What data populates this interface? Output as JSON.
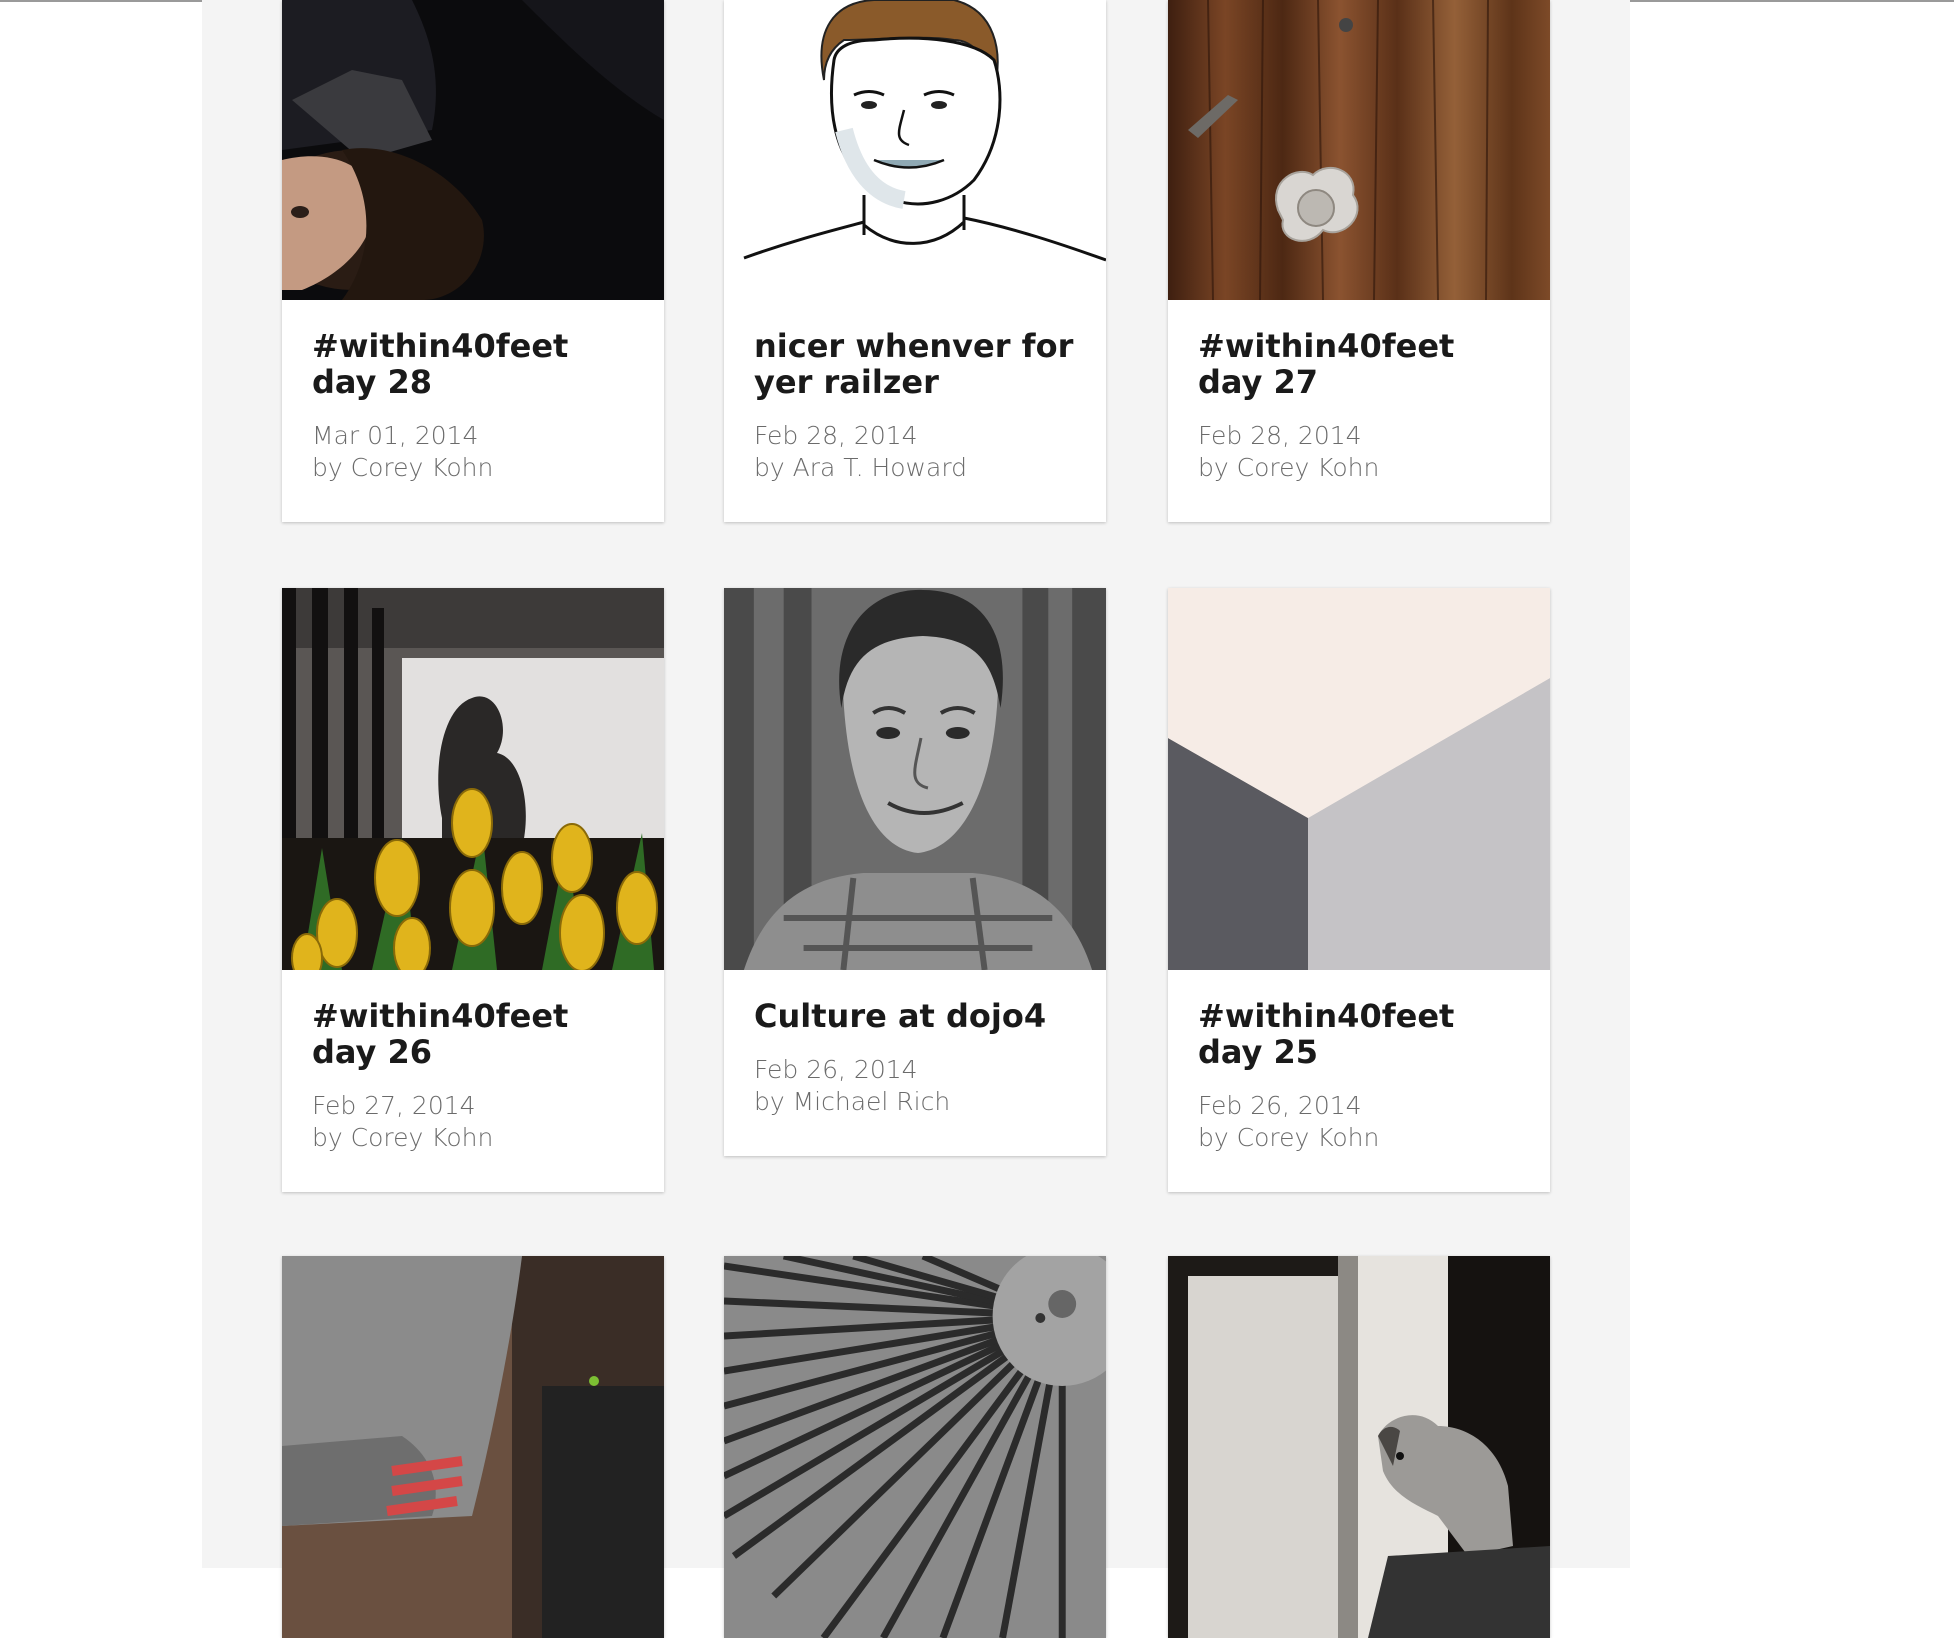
{
  "posts": [
    {
      "title": "#within40feet day 28",
      "date": "Mar 01, 2014",
      "author": "by Corey Kohn",
      "image": "dark-portrait-photo"
    },
    {
      "title": "nicer whenver for yer railzer",
      "date": "Feb 28, 2014",
      "author": "by Ara T. Howard",
      "image": "sketched-portrait"
    },
    {
      "title": "#within40feet day 27",
      "date": "Feb 28, 2014",
      "author": "by Corey Kohn",
      "image": "wood-door-photo"
    },
    {
      "title": "#within40feet day 26",
      "date": "Feb 27, 2014",
      "author": "by Corey Kohn",
      "image": "tulips-photo"
    },
    {
      "title": "Culture at dojo4",
      "date": "Feb 26, 2014",
      "author": "by Michael Rich",
      "image": "bw-portrait-photo"
    },
    {
      "title": "#within40feet day 25",
      "date": "Feb 26, 2014",
      "author": "by Corey Kohn",
      "image": "wall-corner-photo"
    },
    {
      "title": "",
      "date": "",
      "author": "",
      "image": "sweater-photo"
    },
    {
      "title": "",
      "date": "",
      "author": "",
      "image": "fan-grill-photo"
    },
    {
      "title": "",
      "date": "",
      "author": "",
      "image": "dog-doorway-photo"
    }
  ]
}
